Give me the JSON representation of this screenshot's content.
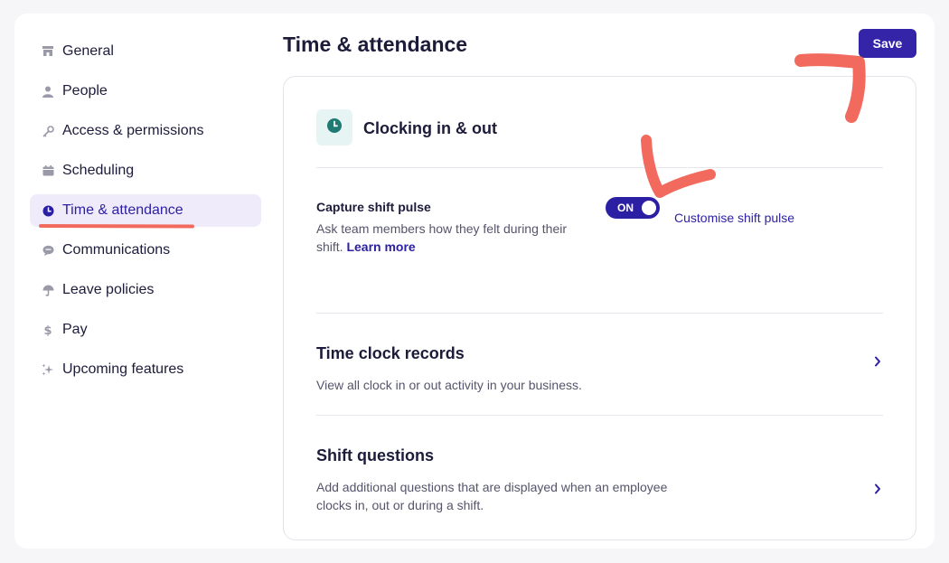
{
  "sidebar": {
    "items": [
      {
        "label": "General",
        "icon": "store-icon"
      },
      {
        "label": "People",
        "icon": "person-icon"
      },
      {
        "label": "Access & permissions",
        "icon": "key-icon"
      },
      {
        "label": "Scheduling",
        "icon": "calendar-icon"
      },
      {
        "label": "Time & attendance",
        "icon": "clock-icon",
        "active": true
      },
      {
        "label": "Communications",
        "icon": "chat-icon"
      },
      {
        "label": "Leave policies",
        "icon": "umbrella-icon"
      },
      {
        "label": "Pay",
        "icon": "dollar-icon"
      },
      {
        "label": "Upcoming features",
        "icon": "sparkle-icon"
      }
    ]
  },
  "header": {
    "title": "Time & attendance",
    "save_label": "Save"
  },
  "section": {
    "title": "Clocking in & out",
    "icon": "clock-icon",
    "shift_pulse": {
      "title": "Capture shift pulse",
      "description": "Ask team members how they felt during their shift.",
      "learn_more": "Learn more",
      "toggle_label": "ON",
      "toggle_on": true,
      "customise_link": "Customise shift pulse"
    },
    "rows": [
      {
        "title": "Time clock records",
        "description": "View all clock in or out activity in your business."
      },
      {
        "title": "Shift questions",
        "description": "Add additional questions that are displayed when an employee clocks in, out or during a shift."
      }
    ]
  },
  "colors": {
    "accent": "#3324a8",
    "active_bg": "#efebfb",
    "annotation": "#f26a5e",
    "icon_teal": "#1f7a73"
  }
}
